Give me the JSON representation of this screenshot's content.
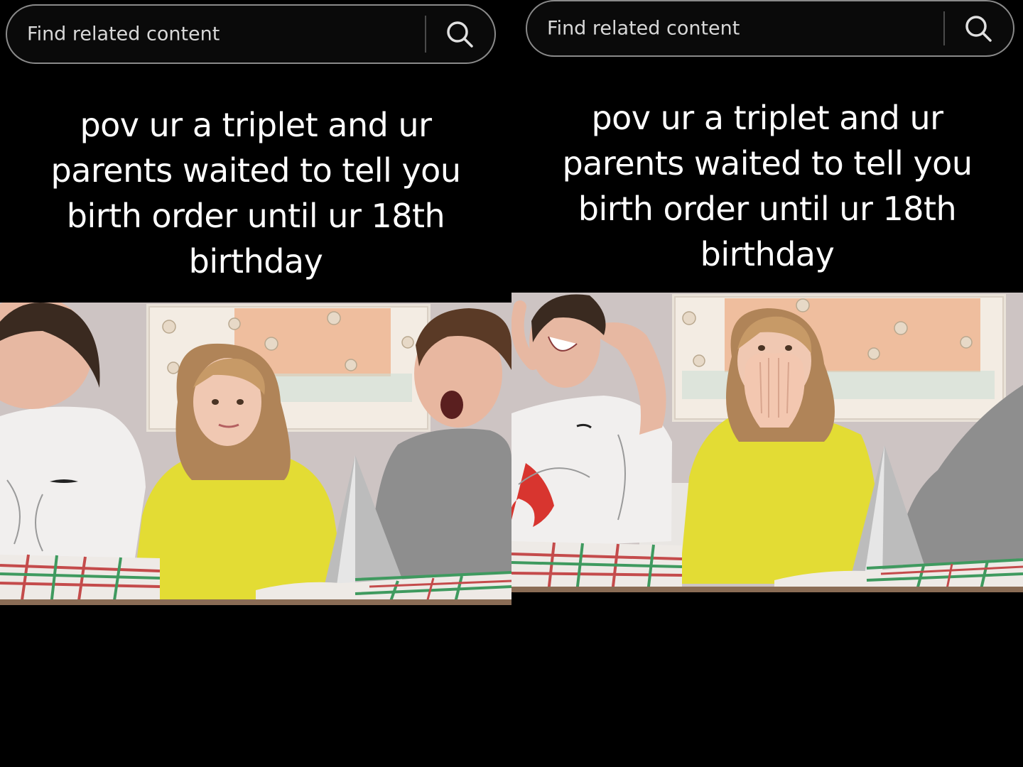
{
  "panels": [
    {
      "search": {
        "placeholder": "Find related content",
        "icon": "search-icon"
      },
      "caption": [
        "pov ur a triplet and ur",
        "parents waited to tell you",
        "birth order until ur 18th",
        "birthday"
      ]
    },
    {
      "search": {
        "placeholder": "Find related content",
        "icon": "search-icon"
      },
      "caption": [
        "pov ur a triplet and ur",
        "parents waited to tell you",
        "birth order until ur 18th",
        "birthday"
      ]
    }
  ],
  "colors": {
    "background": "#000000",
    "search_border": "#8a8a8a",
    "text": "#ffffff",
    "wall": "#cfc6c6",
    "sweater_yellow": "#e3dc34",
    "shirt_gray": "#8e8e8e",
    "shirt_white": "#f1efee"
  }
}
